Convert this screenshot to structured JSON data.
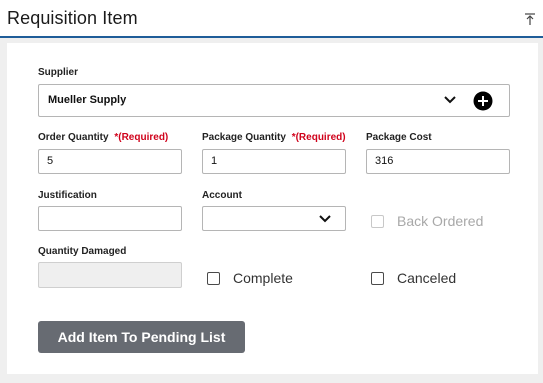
{
  "header": {
    "title": "Requisition Item",
    "collapse_icon": "collapse-up-icon"
  },
  "form": {
    "supplier": {
      "label": "Supplier",
      "value": "Mueller Supply",
      "chevron_icon": "chevron-down-icon",
      "add_icon": "add-circle-icon"
    },
    "order_quantity": {
      "label": "Order Quantity",
      "required_text": "*(Required)",
      "value": "5"
    },
    "package_quantity": {
      "label": "Package Quantity",
      "required_text": "*(Required)",
      "value": "1"
    },
    "package_cost": {
      "label": "Package Cost",
      "value": "316"
    },
    "justification": {
      "label": "Justification",
      "value": ""
    },
    "account": {
      "label": "Account",
      "value": "",
      "chevron_icon": "chevron-down-icon"
    },
    "back_ordered": {
      "label": "Back Ordered",
      "checked": false,
      "disabled": true
    },
    "quantity_damaged": {
      "label": "Quantity Damaged",
      "value": "",
      "disabled": true
    },
    "complete": {
      "label": "Complete",
      "checked": false
    },
    "canceled": {
      "label": "Canceled",
      "checked": false
    },
    "add_button_label": "Add Item To Pending List"
  },
  "colors": {
    "accent_border": "#1f5d99",
    "required": "#d0021b",
    "button_bg": "#676b72",
    "page_bg": "#efefef"
  }
}
